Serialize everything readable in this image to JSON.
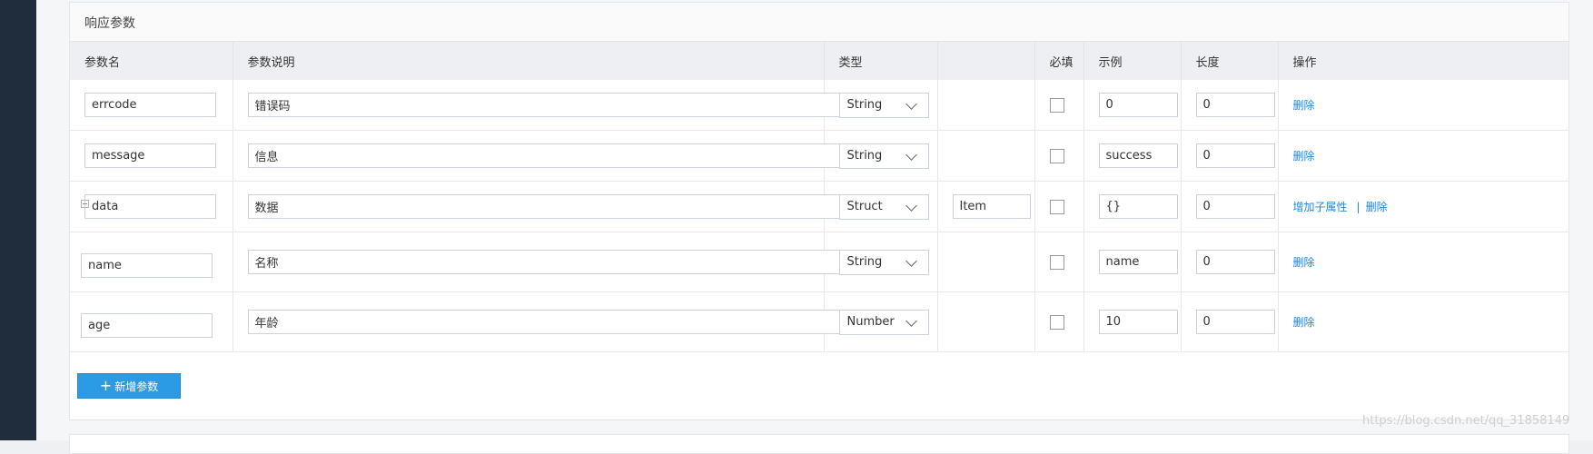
{
  "section_title": "响应参数",
  "columns": {
    "name": "参数名",
    "desc": "参数说明",
    "type": "类型",
    "ref": "",
    "required": "必填",
    "example": "示例",
    "length": "长度",
    "action": "操作"
  },
  "rows": [
    {
      "name": "errcode",
      "desc": "错误码",
      "type": "String",
      "ref": "",
      "required": false,
      "example": "0",
      "length": "0"
    },
    {
      "name": "message",
      "desc": "信息",
      "type": "String",
      "ref": "",
      "required": false,
      "example": "success",
      "length": "0"
    },
    {
      "name": "data",
      "desc": "数据",
      "type": "Struct",
      "ref": "Item",
      "required": false,
      "example": "{}",
      "length": "0"
    },
    {
      "name": "name",
      "desc": "名称",
      "type": "String",
      "ref": "",
      "required": false,
      "example": "name",
      "length": "0"
    },
    {
      "name": "age",
      "desc": "年龄",
      "type": "Number",
      "ref": "",
      "required": false,
      "example": "10",
      "length": "0"
    }
  ],
  "actions": {
    "delete": "删除",
    "add_child": "增加子属性",
    "separator": "|"
  },
  "add_button": {
    "icon": "plus-icon",
    "label": "新增参数"
  },
  "watermark": "https://blog.csdn.net/qq_31858149",
  "colors": {
    "accent": "#2c9be6",
    "link": "#1e88d8",
    "sidebar": "#1f2d3d"
  }
}
